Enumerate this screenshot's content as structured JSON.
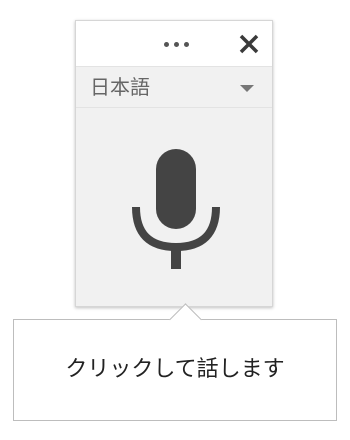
{
  "panel": {
    "more_icon": "more-horizontal-icon",
    "close_icon": "close-icon",
    "language": {
      "selected": "日本語",
      "arrow_icon": "dropdown-arrow-icon"
    },
    "mic_icon": "microphone-icon"
  },
  "tooltip": {
    "text": "クリックして話します"
  },
  "colors": {
    "panel_background": "#f1f1f1",
    "header_background": "#ffffff",
    "icon_dark": "#444444",
    "text_muted": "#666666",
    "tooltip_border": "#bdbdbd"
  }
}
